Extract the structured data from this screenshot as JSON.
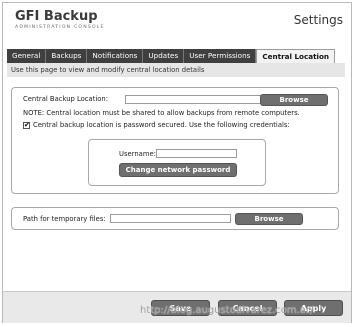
{
  "header": {
    "logo_main": "GFI Backup",
    "logo_sub": "ADMINISTRATION CONSOLE",
    "page_title": "Settings"
  },
  "tabs": [
    {
      "label": "General"
    },
    {
      "label": "Backups"
    },
    {
      "label": "Notifications"
    },
    {
      "label": "Updates"
    },
    {
      "label": "User Permissions"
    },
    {
      "label": "Central Location",
      "active": true
    }
  ],
  "info_text": "Use this page to view and modify central location details",
  "central": {
    "location_label": "Central Backup Location:",
    "location_value": "",
    "browse_label": "Browse",
    "note": "NOTE: Central location must be shared to allow backups from remote computers.",
    "secured_checked": true,
    "secured_label": "Central backup location is password secured. Use the following credentials:",
    "username_label": "Username:",
    "username_value": "",
    "change_password_label": "Change network password"
  },
  "temp": {
    "path_label": "Path for temporary files:",
    "path_value": "",
    "browse_label": "Browse"
  },
  "footer": {
    "save_label": "Save",
    "cancel_label": "Cancel",
    "apply_label": "Apply"
  },
  "watermark": "http://blog.augustoalvarez.com.ar/"
}
